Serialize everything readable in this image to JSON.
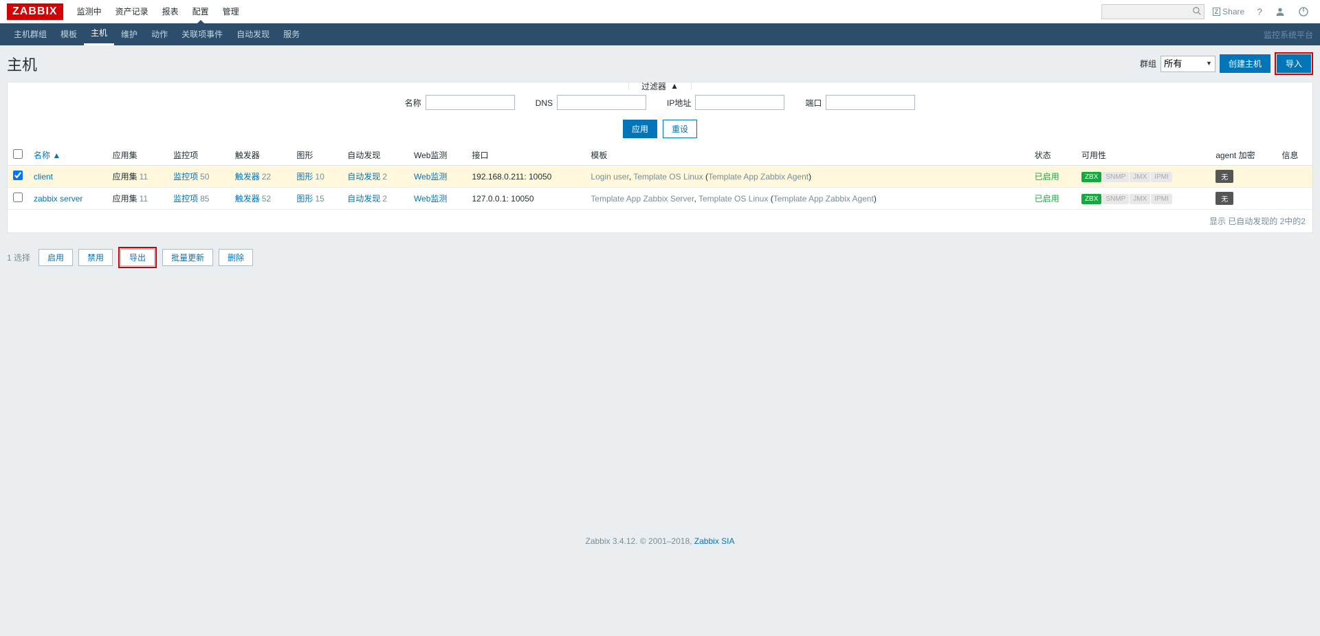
{
  "logo": "ZABBIX",
  "topnav": {
    "items": [
      "监测中",
      "资产记录",
      "报表",
      "配置",
      "管理"
    ],
    "active_index": 3,
    "share": "Share"
  },
  "subnav": {
    "items": [
      "主机群组",
      "模板",
      "主机",
      "维护",
      "动作",
      "关联项事件",
      "自动发现",
      "服务"
    ],
    "active_index": 2,
    "right": "监控系统平台"
  },
  "page": {
    "title": "主机",
    "group_label": "群组",
    "group_value": "所有",
    "create_btn": "创建主机",
    "import_btn": "导入"
  },
  "filter": {
    "tab": "过滤器",
    "name_label": "名称",
    "dns_label": "DNS",
    "ip_label": "IP地址",
    "port_label": "端口",
    "apply": "应用",
    "reset": "重设"
  },
  "table": {
    "headers": {
      "name": "名称",
      "apps": "应用集",
      "items": "监控项",
      "triggers": "触发器",
      "graphs": "图形",
      "discovery": "自动发现",
      "web": "Web监测",
      "iface": "接口",
      "templates": "模板",
      "status": "状态",
      "avail": "可用性",
      "encrypt": "agent 加密",
      "info": "信息"
    },
    "sort_indicator": "▲",
    "rows": [
      {
        "checked": true,
        "name": "client",
        "apps_label": "应用集",
        "apps_n": "11",
        "items_label": "监控项",
        "items_n": "50",
        "trig_label": "触发器",
        "trig_n": "22",
        "graph_label": "图形",
        "graph_n": "10",
        "disc_label": "自动发现",
        "disc_n": "2",
        "web_label": "Web监测",
        "iface": "192.168.0.211: 10050",
        "templates_plain": [
          "Login user",
          "Template OS Linux"
        ],
        "templates_paren": [
          "Template App Zabbix Agent"
        ],
        "status": "已启用",
        "encrypt": "无"
      },
      {
        "checked": false,
        "name": "zabbix server",
        "apps_label": "应用集",
        "apps_n": "11",
        "items_label": "监控项",
        "items_n": "85",
        "trig_label": "触发器",
        "trig_n": "52",
        "graph_label": "图形",
        "graph_n": "15",
        "disc_label": "自动发现",
        "disc_n": "2",
        "web_label": "Web监测",
        "iface": "127.0.0.1: 10050",
        "templates_plain": [
          "Template App Zabbix Server",
          "Template OS Linux"
        ],
        "templates_paren": [
          "Template App Zabbix Agent"
        ],
        "status": "已启用",
        "encrypt": "无"
      }
    ],
    "avail_badges": [
      "ZBX",
      "SNMP",
      "JMX",
      "IPMI"
    ],
    "footer_text": "显示 已自动发现的 2中的2"
  },
  "bulk": {
    "selected": "1 选择",
    "enable": "启用",
    "disable": "禁用",
    "export": "导出",
    "massupdate": "批量更新",
    "delete": "删除"
  },
  "footer": {
    "text": "Zabbix 3.4.12. © 2001–2018, ",
    "link": "Zabbix SIA"
  }
}
